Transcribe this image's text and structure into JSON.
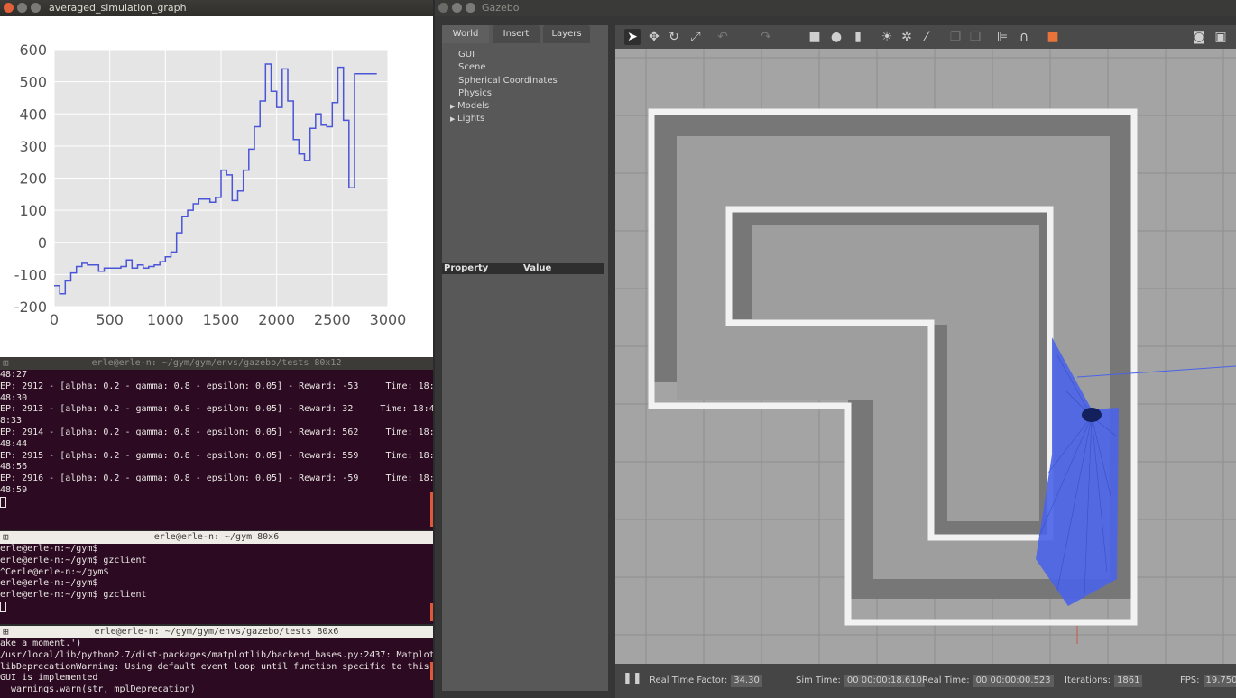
{
  "graph_window": {
    "title": "averaged_simulation_graph"
  },
  "chart_data": {
    "type": "line",
    "title": "",
    "xlabel": "",
    "ylabel": "",
    "xlim": [
      0,
      3000
    ],
    "ylim": [
      -200,
      600
    ],
    "xticks": [
      0,
      500,
      1000,
      1500,
      2000,
      2500,
      3000
    ],
    "yticks": [
      -200,
      -100,
      0,
      100,
      200,
      300,
      400,
      500,
      600
    ],
    "grid": true,
    "line_color": "#4a55d8",
    "background": "#e5e5e5",
    "step": true,
    "x": [
      0,
      50,
      100,
      150,
      200,
      250,
      300,
      350,
      400,
      450,
      500,
      550,
      600,
      650,
      700,
      750,
      800,
      850,
      900,
      950,
      1000,
      1050,
      1100,
      1150,
      1200,
      1250,
      1300,
      1350,
      1400,
      1450,
      1500,
      1550,
      1600,
      1650,
      1700,
      1750,
      1800,
      1850,
      1900,
      1950,
      2000,
      2050,
      2100,
      2150,
      2200,
      2250,
      2300,
      2350,
      2400,
      2450,
      2500,
      2550,
      2600,
      2650,
      2700,
      2750,
      2800,
      2850
    ],
    "y": [
      -135,
      -160,
      -120,
      -95,
      -75,
      -65,
      -70,
      -70,
      -90,
      -80,
      -80,
      -80,
      -75,
      -55,
      -80,
      -70,
      -80,
      -75,
      -70,
      -60,
      -45,
      -30,
      30,
      80,
      100,
      120,
      135,
      135,
      125,
      140,
      225,
      210,
      130,
      160,
      225,
      290,
      360,
      440,
      555,
      470,
      420,
      540,
      440,
      320,
      275,
      255,
      355,
      400,
      365,
      360,
      435,
      545,
      380,
      170,
      525,
      525,
      525,
      525
    ]
  },
  "terminal1": {
    "title": "erle@erle-n: ~/gym/gym/envs/gazebo/tests 80x12",
    "lines": [
      "48:27",
      "EP: 2912 - [alpha: 0.2 - gamma: 0.8 - epsilon: 0.05] - Reward: -53     Time: 18:",
      "48:30",
      "EP: 2913 - [alpha: 0.2 - gamma: 0.8 - epsilon: 0.05] - Reward: 32     Time: 18:4",
      "8:33",
      "EP: 2914 - [alpha: 0.2 - gamma: 0.8 - epsilon: 0.05] - Reward: 562     Time: 18:",
      "48:44",
      "EP: 2915 - [alpha: 0.2 - gamma: 0.8 - epsilon: 0.05] - Reward: 559     Time: 18:",
      "48:56",
      "EP: 2916 - [alpha: 0.2 - gamma: 0.8 - epsilon: 0.05] - Reward: -59     Time: 18:",
      "48:59"
    ]
  },
  "terminal2": {
    "title": "erle@erle-n: ~/gym 80x6",
    "lines": [
      "erle@erle-n:~/gym$",
      "erle@erle-n:~/gym$ gzclient",
      "^Cerle@erle-n:~/gym$",
      "erle@erle-n:~/gym$",
      "erle@erle-n:~/gym$ gzclient"
    ]
  },
  "terminal3": {
    "title": "erle@erle-n: ~/gym/gym/envs/gazebo/tests 80x6",
    "lines": [
      "ake a moment.')",
      "/usr/local/lib/python2.7/dist-packages/matplotlib/backend_bases.py:2437: Matplot",
      "libDeprecationWarning: Using default event loop until function specific to this",
      "GUI is implemented",
      "  warnings.warn(str, mplDeprecation)"
    ]
  },
  "gazebo": {
    "title": "Gazebo",
    "tabs": [
      "World",
      "Insert",
      "Layers"
    ],
    "tree": [
      "GUI",
      "Scene",
      "Spherical Coordinates",
      "Physics",
      "Models",
      "Lights"
    ],
    "property_header": [
      "Property",
      "Value"
    ],
    "status": {
      "rtf_label": "Real Time Factor:",
      "rtf_value": "34.30",
      "sim_label": "Sim Time:",
      "sim_value": "00 00:00:18.610",
      "real_label": "Real Time:",
      "real_value": "00 00:00:00.523",
      "iter_label": "Iterations:",
      "iter_value": "1861",
      "fps_label": "FPS:",
      "fps_value": "19.750"
    },
    "toolbar_icons": [
      "select-arrow-icon",
      "translate-icon",
      "rotate-icon",
      "scale-icon",
      "undo-icon",
      "redo-icon",
      "box-icon",
      "sphere-icon",
      "cylinder-icon",
      "point-light-icon",
      "spot-light-icon",
      "directional-light-icon",
      "copy-icon",
      "paste-icon",
      "align-icon",
      "snap-icon",
      "view-angle-icon",
      "screenshot-icon",
      "log-icon"
    ]
  }
}
